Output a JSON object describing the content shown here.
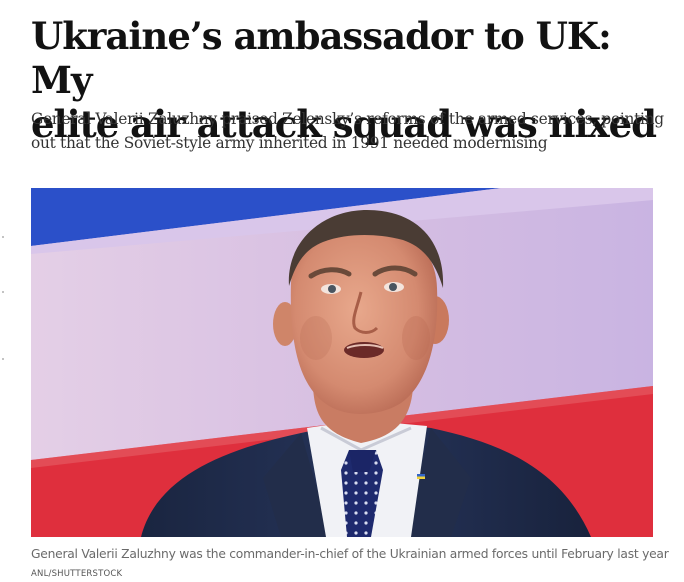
{
  "article": {
    "headline_line1": "Ukraine’s ambassador to UK: My",
    "headline_line2": "elite air attack squad was nixed",
    "standfirst_line1": "General Valerii Zaluzhny praised Zelensky’s reforms of the armed services, pointing",
    "standfirst_line2": "out that the Soviet-style army inherited in 1991 needed modernising"
  },
  "photo": {
    "caption": "General Valerii Zaluzhny was the commander-in-chief of the Ukrainian armed forces until February last year",
    "credit": "ANL/SHUTTERSTOCK"
  },
  "colors": {
    "backdrop_blue": "#2b50c9",
    "backdrop_lilac": "#dcc4e4",
    "backdrop_red": "#e0303e",
    "suit_navy": "#1f2a44"
  }
}
